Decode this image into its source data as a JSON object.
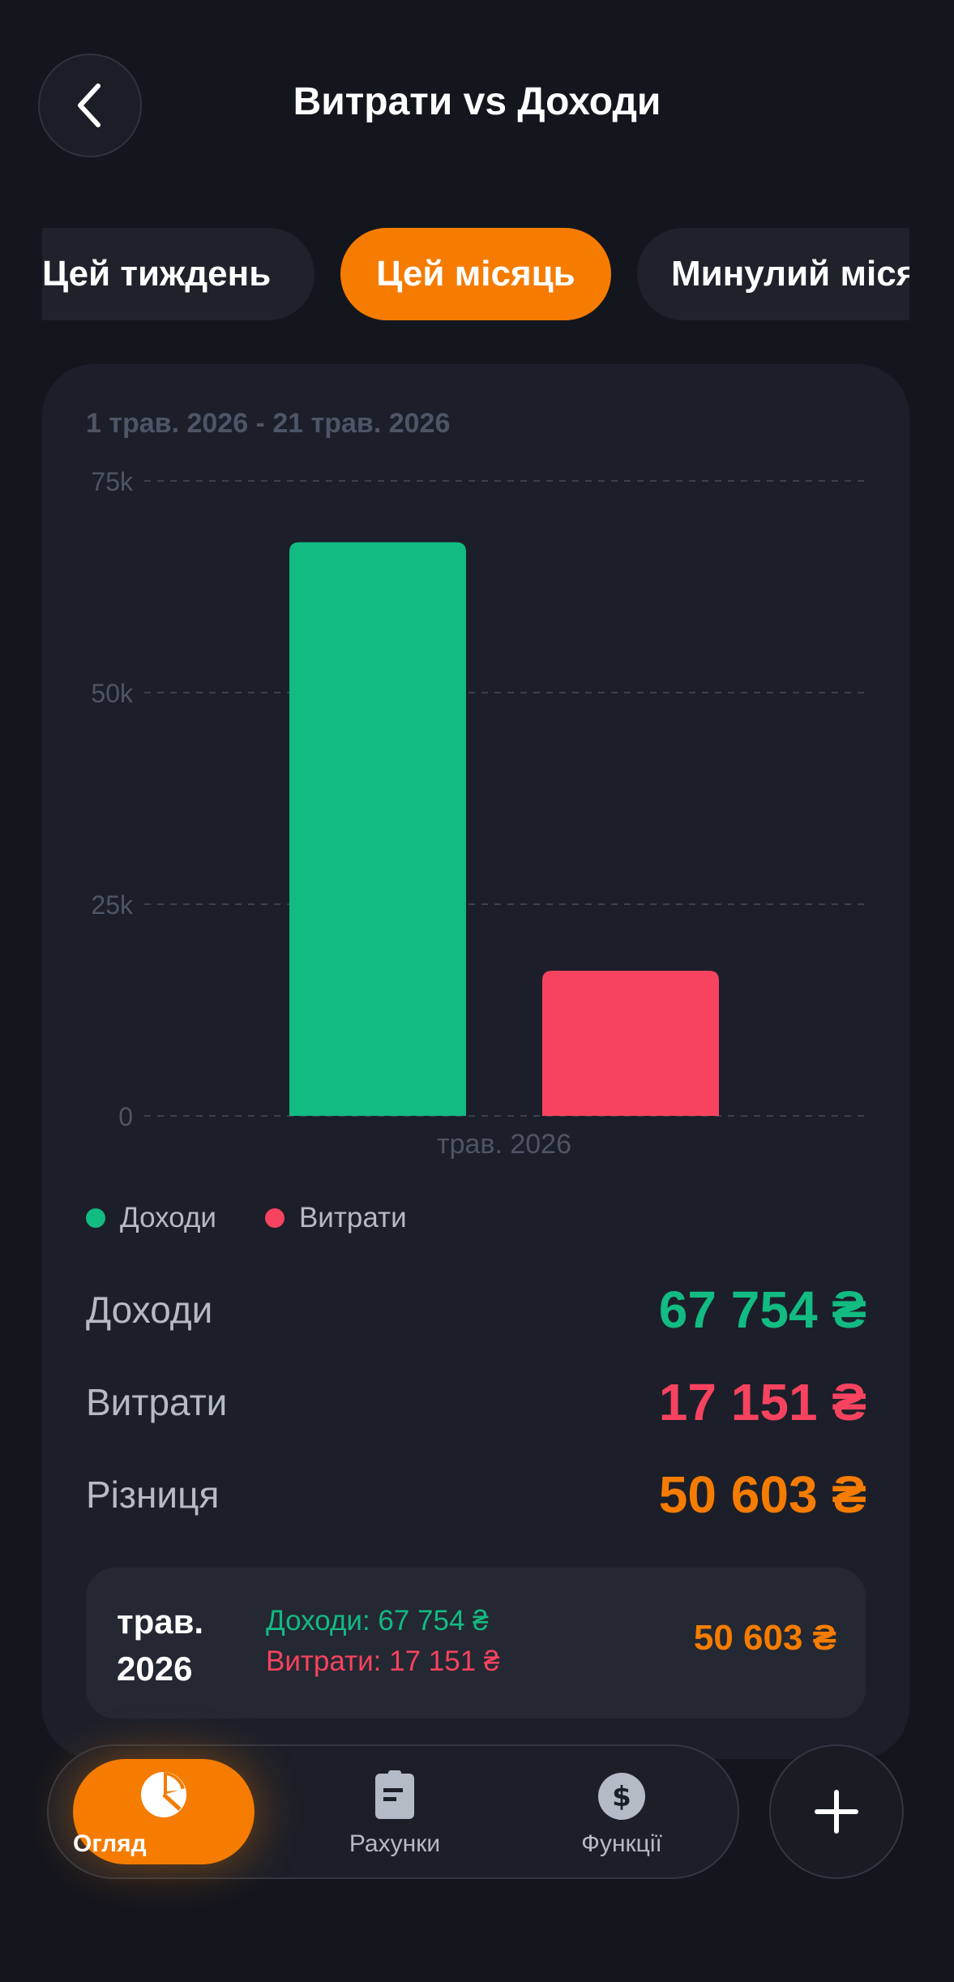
{
  "header": {
    "title": "Витрати vs Доходи"
  },
  "tabs": [
    {
      "label": "Цей тиждень",
      "active": false
    },
    {
      "label": "Цей місяць",
      "active": true
    },
    {
      "label": "Минулий місяць",
      "active": false
    }
  ],
  "card": {
    "date_range": "1 трав. 2026 - 21 трав. 2026"
  },
  "chart_data": {
    "type": "bar",
    "categories": [
      "трав. 2026"
    ],
    "series": [
      {
        "name": "Доходи",
        "values": [
          67754
        ],
        "color": "#12bb82"
      },
      {
        "name": "Витрати",
        "values": [
          17151
        ],
        "color": "#f7435f"
      }
    ],
    "yticks": [
      "0",
      "25k",
      "50k",
      "75k"
    ],
    "ytick_values": [
      0,
      25000,
      50000,
      75000
    ],
    "ylim": [
      0,
      75000
    ],
    "grid": true,
    "legend_position": "bottom-left"
  },
  "summary": {
    "income_label": "Доходи",
    "income_value": "67 754 ₴",
    "expense_label": "Витрати",
    "expense_value": "17 151 ₴",
    "diff_label": "Різниця",
    "diff_value": "50 603 ₴"
  },
  "period": {
    "name": "трав. 2026",
    "income": "Доходи: 67 754 ₴",
    "expense": "Витрати: 17 151 ₴",
    "diff": "50 603 ₴"
  },
  "nav": {
    "items": [
      {
        "label": "Огляд",
        "icon": "pie-chart-icon",
        "active": true
      },
      {
        "label": "Рахунки",
        "icon": "receipt-icon",
        "active": false
      },
      {
        "label": "Функції",
        "icon": "dollar-icon",
        "active": false
      }
    ],
    "fab_icon": "plus-icon"
  },
  "colors": {
    "accent": "#f57c00",
    "income": "#12bb82",
    "expense": "#f7435f"
  }
}
